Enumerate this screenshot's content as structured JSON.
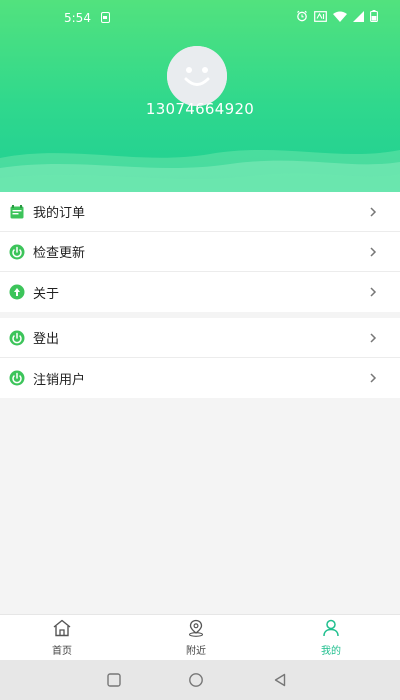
{
  "status_bar": {
    "time": "5:54"
  },
  "profile": {
    "phone": "13074664920"
  },
  "menu": {
    "group1": [
      {
        "label": "我的订单",
        "icon": "order-icon"
      },
      {
        "label": "检查更新",
        "icon": "power-icon"
      },
      {
        "label": "关于",
        "icon": "info-icon"
      }
    ],
    "group2": [
      {
        "label": "登出",
        "icon": "power-icon"
      },
      {
        "label": "注销用户",
        "icon": "power-icon"
      }
    ]
  },
  "bottom_nav": {
    "tabs": [
      {
        "label": "首页",
        "icon": "home-icon"
      },
      {
        "label": "附近",
        "icon": "location-icon"
      },
      {
        "label": "我的",
        "icon": "user-icon"
      }
    ],
    "active_index": 2
  },
  "colors": {
    "header_start": "#52e27e",
    "header_end": "#1fcf94",
    "accent": "#1fbf8e",
    "icon_green": "#3cc45a"
  }
}
